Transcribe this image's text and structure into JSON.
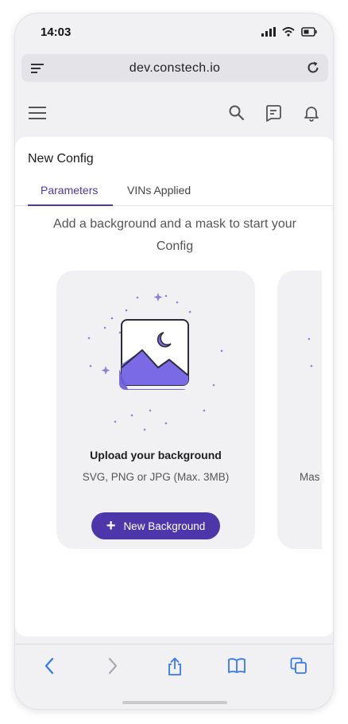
{
  "status": {
    "time": "14:03"
  },
  "browser": {
    "url": "dev.constech.io"
  },
  "page": {
    "title": "New Config",
    "tabs": [
      {
        "label": "Parameters",
        "active": true
      },
      {
        "label": "VINs Applied",
        "active": false
      }
    ],
    "intro": "Add a background and a mask to start your Config"
  },
  "upload_background": {
    "title": "Upload your background",
    "subtitle": "SVG, PNG or JPG (Max. 3MB)",
    "button_label": "New Background"
  },
  "upload_mask": {
    "subtitle_partial": "Mas"
  },
  "icons": {
    "header": [
      "menu-icon",
      "search-icon",
      "chat-icon",
      "bell-icon"
    ],
    "toolbar": [
      "back-icon",
      "forward-icon",
      "share-icon",
      "bookmarks-icon",
      "tabs-icon"
    ]
  },
  "colors": {
    "accent": "#4d36a9",
    "accent_light": "#7b6ae6",
    "ios_blue": "#3478f6"
  }
}
